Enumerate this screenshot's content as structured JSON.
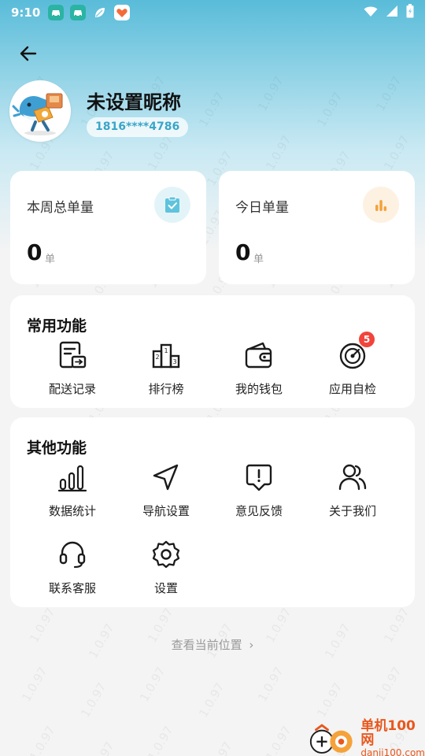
{
  "status_bar": {
    "time": "9:10",
    "app_icons": [
      "car-icon",
      "car-icon",
      "leaf-icon",
      "heart-icon"
    ],
    "indicators": [
      "wifi-icon",
      "signal-icon",
      "battery-icon"
    ]
  },
  "profile": {
    "nickname": "未设置昵称",
    "phone": "1816****4786"
  },
  "stats": {
    "weekly": {
      "label": "本周总单量",
      "value": "0",
      "unit": "单",
      "icon": "clipboard-check-icon",
      "color": "#5fc3dc"
    },
    "today": {
      "label": "今日单量",
      "value": "0",
      "unit": "单",
      "icon": "bar-chart-icon",
      "color": "#f5a23b"
    }
  },
  "common_functions": {
    "title": "常用功能",
    "items": [
      {
        "label": "配送记录",
        "icon": "delivery-record-icon"
      },
      {
        "label": "排行榜",
        "icon": "podium-icon"
      },
      {
        "label": "我的钱包",
        "icon": "wallet-icon"
      },
      {
        "label": "应用自检",
        "icon": "self-check-icon",
        "badge": "5"
      }
    ]
  },
  "other_functions": {
    "title": "其他功能",
    "items": [
      {
        "label": "数据统计",
        "icon": "statistics-icon"
      },
      {
        "label": "导航设置",
        "icon": "navigation-icon"
      },
      {
        "label": "意见反馈",
        "icon": "feedback-icon"
      },
      {
        "label": "关于我们",
        "icon": "about-us-icon"
      },
      {
        "label": "联系客服",
        "icon": "headset-icon"
      },
      {
        "label": "设置",
        "icon": "gear-icon"
      }
    ]
  },
  "footer": {
    "location_link": "查看当前位置",
    "location_chevron": "›"
  },
  "watermark": "1.0.97",
  "corner_badge": {
    "line1": "单机100网",
    "line2": "danji100.com"
  },
  "colors": {
    "accent": "#3aa5c8",
    "badge": "#f2443b",
    "orange": "#f5a23b"
  }
}
